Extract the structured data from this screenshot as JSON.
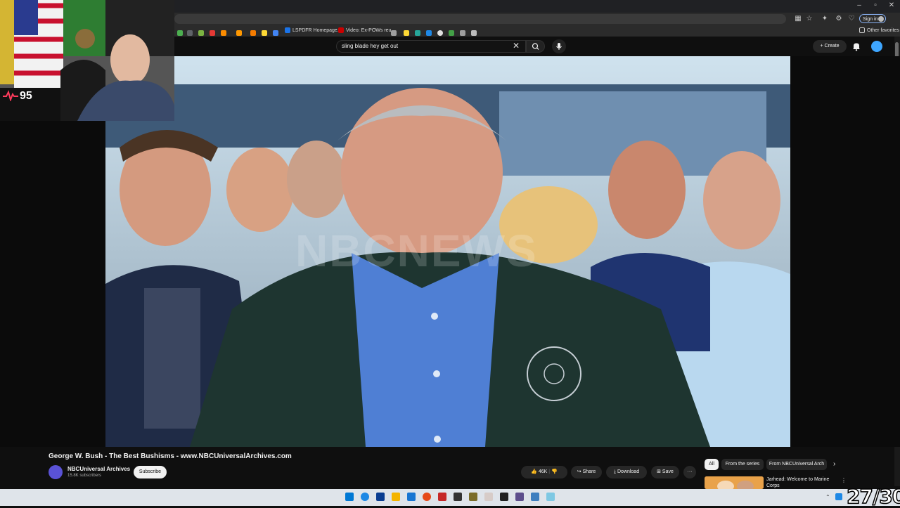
{
  "browser": {
    "search_query": "sling blade hey get out",
    "signin_label": "Sign in",
    "bookmarks": [
      {
        "label": "LSPDFR Homepage...",
        "color": "#1a73e8"
      },
      {
        "label": "Video: Ex-POWs reu...",
        "color": "#cc0000"
      }
    ],
    "other_favorites_label": "Other favorites",
    "window_controls": [
      "–",
      "▫",
      "✕"
    ]
  },
  "youtube": {
    "create_label": "Create",
    "video": {
      "title": "George W. Bush - The Best Bushisms - www.NBCUniversalArchives.com",
      "watermark": "NBCNEWS",
      "channel_name": "NBCUniversal Archives",
      "subscribers": "15.8K subscribers",
      "subscribe_label": "Subscribe",
      "likes": "46K",
      "share_label": "Share",
      "download_label": "Download",
      "save_label": "Save",
      "more_label": "···"
    },
    "chips": [
      "All",
      "From the series",
      "From NBCUniversal Arch"
    ],
    "recommended": {
      "title": "Jarhead: Welcome to Marine Corps"
    }
  },
  "overlay": {
    "heart_rate": "95",
    "counter": "27/30"
  },
  "colors": {
    "accent": "#3ea6ff",
    "brand_red": "#ff0000",
    "taskbar": "#dfe4ea"
  }
}
